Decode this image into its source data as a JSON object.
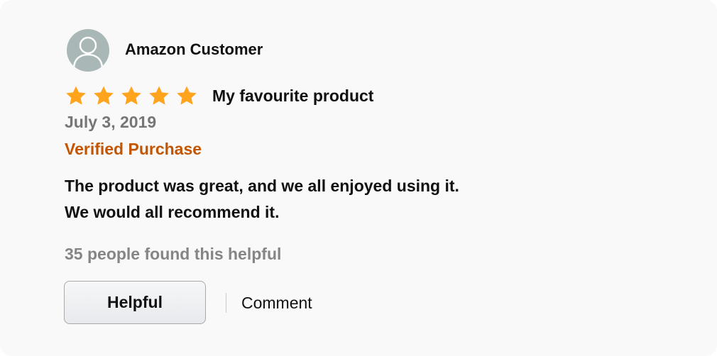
{
  "reviewer": {
    "name": "Amazon Customer",
    "avatar_icon": "person-silhouette-icon"
  },
  "review": {
    "rating": 5,
    "rating_max": 5,
    "star_icon": "star-icon",
    "star_color": "#ffa41c",
    "title": "My favourite product",
    "date": "July 3, 2019",
    "verified_label": "Verified Purchase",
    "verified_color": "#c45500",
    "body_lines": [
      "The product was great, and we all enjoyed using it.",
      "We would all recommend it."
    ]
  },
  "footer": {
    "helpful_count_text": "35 people found this helpful",
    "helpful_button_label": "Helpful",
    "comment_label": "Comment"
  }
}
